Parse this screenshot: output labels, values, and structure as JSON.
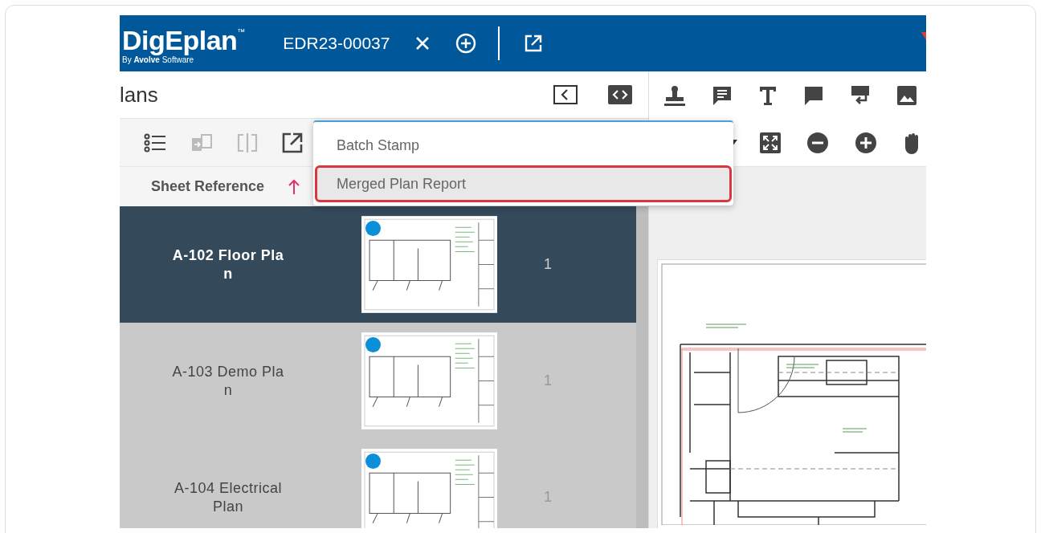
{
  "header": {
    "logo": "DigEplan",
    "logo_mark": "™",
    "byline": "By **Avolve** Software",
    "tab": "EDR23-00037"
  },
  "plans_panel": {
    "title": "lans"
  },
  "table": {
    "columns": [
      {
        "label": "Sheet Reference",
        "sorted_ascending": true
      }
    ],
    "rows": [
      {
        "name": "A-102 Floor Plan",
        "count": "1",
        "selected": true
      },
      {
        "name": "A-103 Demo Plan",
        "count": "1",
        "selected": false
      },
      {
        "name": "A-104 Electrical Plan",
        "count": "1",
        "selected": false
      }
    ]
  },
  "menu": {
    "items": [
      {
        "label": "Batch Stamp",
        "highlighted": false
      },
      {
        "label": "Merged Plan Report",
        "highlighted": true
      }
    ]
  }
}
